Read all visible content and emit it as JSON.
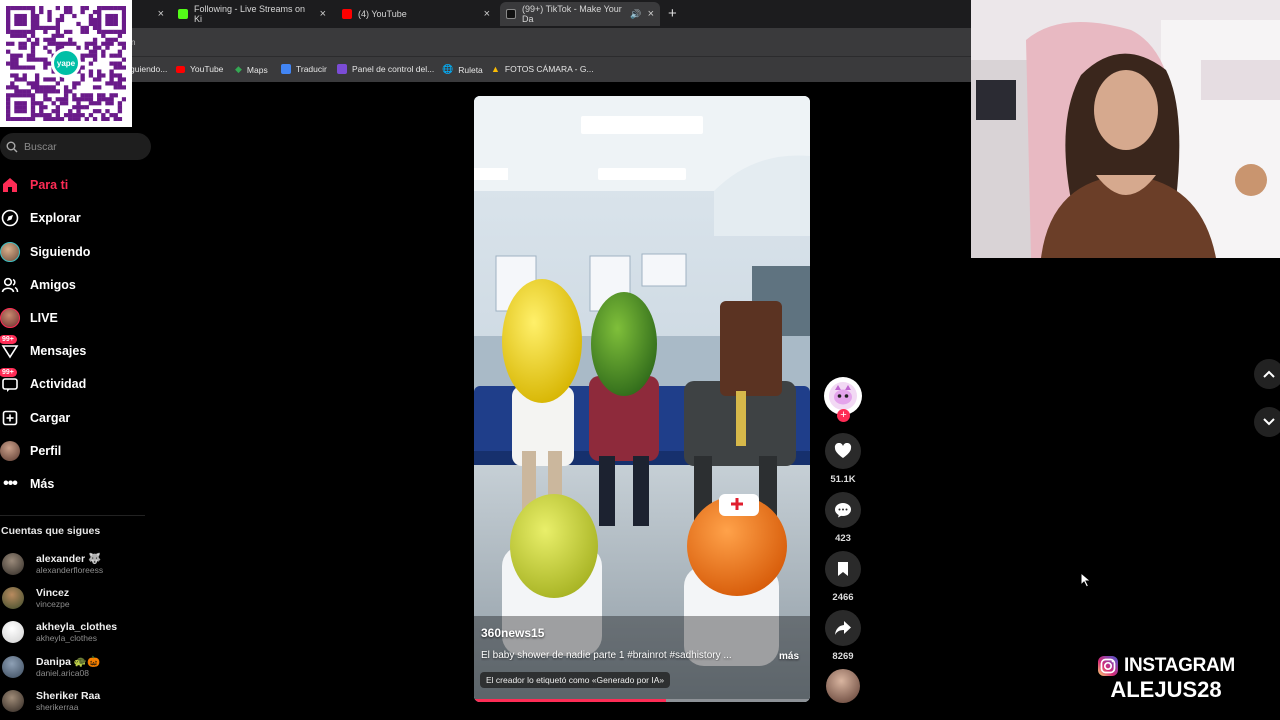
{
  "browser": {
    "tabs": [
      {
        "title": "Following - Live Streams on Ki",
        "close": "×",
        "favicon_color": "#53fc18"
      },
      {
        "title": "(4) YouTube",
        "close": "×",
        "favicon_color": "#ff0000"
      },
      {
        "title": "(99+) TikTok - Make Your Da",
        "close": "×",
        "favicon_color": "#ffffff"
      }
    ],
    "first_tab_close": "×",
    "new_tab": "+",
    "address_fragment": "n",
    "bookmarks": [
      {
        "label": "guiendo..."
      },
      {
        "label": "YouTube",
        "color": "#ff0000"
      },
      {
        "label": "Maps",
        "color": "#34a853"
      },
      {
        "label": "Traducir",
        "color": "#4285f4"
      },
      {
        "label": "Panel de control del...",
        "color": "#7b4cd6"
      },
      {
        "label": "Ruleta",
        "color": "#8ab4f8"
      },
      {
        "label": "FOTOS CÁMARA - G...",
        "color": "#fbbc04"
      }
    ]
  },
  "qr": {
    "brand": "yape"
  },
  "sidebar": {
    "search_placeholder": "Buscar",
    "nav": [
      {
        "label": "Para ti",
        "icon": "home-icon",
        "active": true
      },
      {
        "label": "Explorar",
        "icon": "compass-icon"
      },
      {
        "label": "Siguiendo",
        "icon": "following-avatar-icon"
      },
      {
        "label": "Amigos",
        "icon": "friends-icon"
      },
      {
        "label": "LIVE",
        "icon": "live-icon"
      },
      {
        "label": "Mensajes",
        "icon": "messages-icon",
        "badge": "99+"
      },
      {
        "label": "Actividad",
        "icon": "activity-icon",
        "badge": "99+"
      },
      {
        "label": "Cargar",
        "icon": "upload-icon"
      },
      {
        "label": "Perfil",
        "icon": "profile-avatar-icon"
      },
      {
        "label": "Más",
        "icon": "more-icon"
      }
    ],
    "following_title": "Cuentas que sigues",
    "accounts": [
      {
        "name": "alexander 🐺",
        "handle": "alexanderfloreess"
      },
      {
        "name": "Vincez",
        "handle": "vincezpe"
      },
      {
        "name": "akheyla_clothes",
        "handle": "akheyla_clothes"
      },
      {
        "name": "Danipa 🐢🎃",
        "handle": "daniel.arica08"
      },
      {
        "name": "Sheriker Raa",
        "handle": "sherikerraa"
      }
    ]
  },
  "video": {
    "author": "360news15",
    "caption": "El baby shower de nadie   parte 1  #brainrot #sadhistory ...",
    "more": "más",
    "ai_label": "El creador lo etiquetó como «Generado por IA»",
    "progress": 0.57
  },
  "actions": {
    "likes": "51.1K",
    "comments": "423",
    "saves": "2466",
    "shares": "8269"
  },
  "overlay": {
    "instagram_label": "INSTAGRAM",
    "instagram_handle": "ALEJUS28"
  }
}
